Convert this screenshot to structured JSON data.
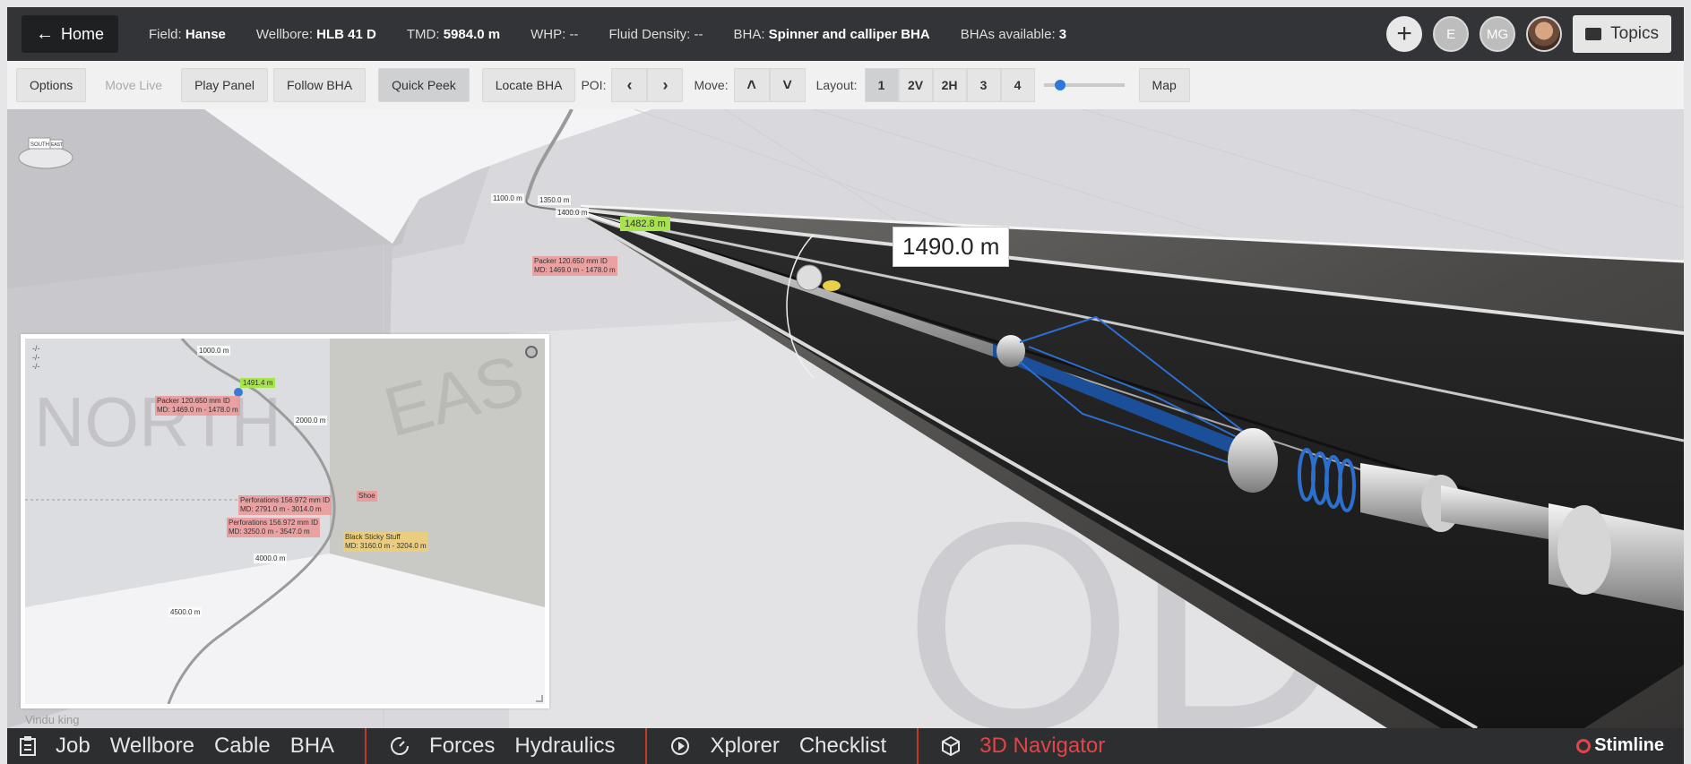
{
  "topbar": {
    "home_label": "Home",
    "field_label": "Field:",
    "field_value": "Hanse",
    "wellbore_label": "Wellbore:",
    "wellbore_value": "HLB 41 D",
    "tmd_label": "TMD:",
    "tmd_value": "5984.0 m",
    "whp_label": "WHP:",
    "whp_value": "--",
    "fluid_label": "Fluid Density:",
    "fluid_value": "--",
    "bha_label": "BHA:",
    "bha_value": "Spinner and calliper BHA",
    "bhas_label": "BHAs available:",
    "bhas_value": "3",
    "avatar_e": "E",
    "avatar_mg": "MG",
    "topics_label": "Topics"
  },
  "toolbar": {
    "options": "Options",
    "move_live": "Move Live",
    "play_panel": "Play Panel",
    "follow_bha": "Follow BHA",
    "quick_peek": "Quick Peek",
    "locate_bha": "Locate BHA",
    "poi_label": "POI:",
    "move_label": "Move:",
    "layout_label": "Layout:",
    "layouts": [
      "1",
      "2V",
      "2H",
      "3",
      "4"
    ],
    "map": "Map"
  },
  "viewport": {
    "compass_south": "SOUTH",
    "compass_east": "EAST",
    "depth_tag": "1490.0 m",
    "bha_depth": "1482.8 m",
    "label_1100": "1100.0 m",
    "label_1350": "1350.0 m",
    "label_1400": "1400.0 m",
    "packer_line1": "Packer 120.650 mm ID",
    "packer_line2": "MD: 1469.0 m - 1478.0 m",
    "ground_text": "OD"
  },
  "minimap": {
    "coords": [
      "-/-",
      "-/-",
      "-/-"
    ],
    "north": "NORTH",
    "east": "EAS",
    "label_1000": "1000.0 m",
    "bha_depth": "1491.4 m",
    "packer_line1": "Packer 120.650 mm ID",
    "packer_line2": "MD: 1469.0 m - 1478.0 m",
    "label_2000": "2000.0 m",
    "perf1_line1": "Perforations 156.972 mm ID",
    "perf1_line2": "MD: 2791.0 m - 3014.0 m",
    "shoe": "Shoe",
    "perf2_line1": "Perforations 156.972 mm ID",
    "perf2_line2": "MD: 3250.0 m - 3547.0 m",
    "sticky_line1": "Black Sticky Stuff",
    "sticky_line2": "MD: 3160.0 m - 3204.0 m",
    "label_4000": "4000.0 m",
    "label_4500": "4500.0 m"
  },
  "vindu_label": "Vindu king",
  "bottombar": {
    "job": "Job",
    "wellbore": "Wellbore",
    "cable": "Cable",
    "bha": "BHA",
    "forces": "Forces",
    "hydraulics": "Hydraulics",
    "xplorer": "Xplorer",
    "checklist": "Checklist",
    "navigator": "3D Navigator",
    "brand": "Stimline"
  },
  "colors": {
    "accent_red": "#e0454a",
    "highlight_green": "#a6e34f",
    "tool_blue": "#1b4f9a"
  }
}
